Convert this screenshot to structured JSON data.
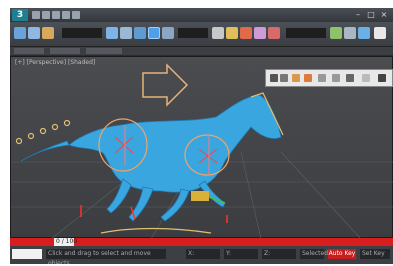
{
  "app": {
    "logo_text": "3",
    "title": "Autodesk 3ds Max"
  },
  "toolbar": {
    "selection_filter": "All",
    "reference_coord": "View",
    "named_selection": "Create Selection Se"
  },
  "viewport": {
    "label": "[+] [Perspective] [Shaded]",
    "object": "horse"
  },
  "trackbar": {
    "visible": true
  },
  "timeslider": {
    "current_frame": "0 / 100"
  },
  "status": {
    "prompt": "Click and drag to select and move objects",
    "x": "X:",
    "y": "Y:",
    "z": "Z:",
    "autokey_label": "Auto Key",
    "set_key_label": "Set Key",
    "selected_label": "Selected"
  },
  "colors": {
    "accent": "#d71d1d",
    "object": "#3aa6e0",
    "bones": "#f0a26a",
    "grid": "#6b6d70"
  }
}
